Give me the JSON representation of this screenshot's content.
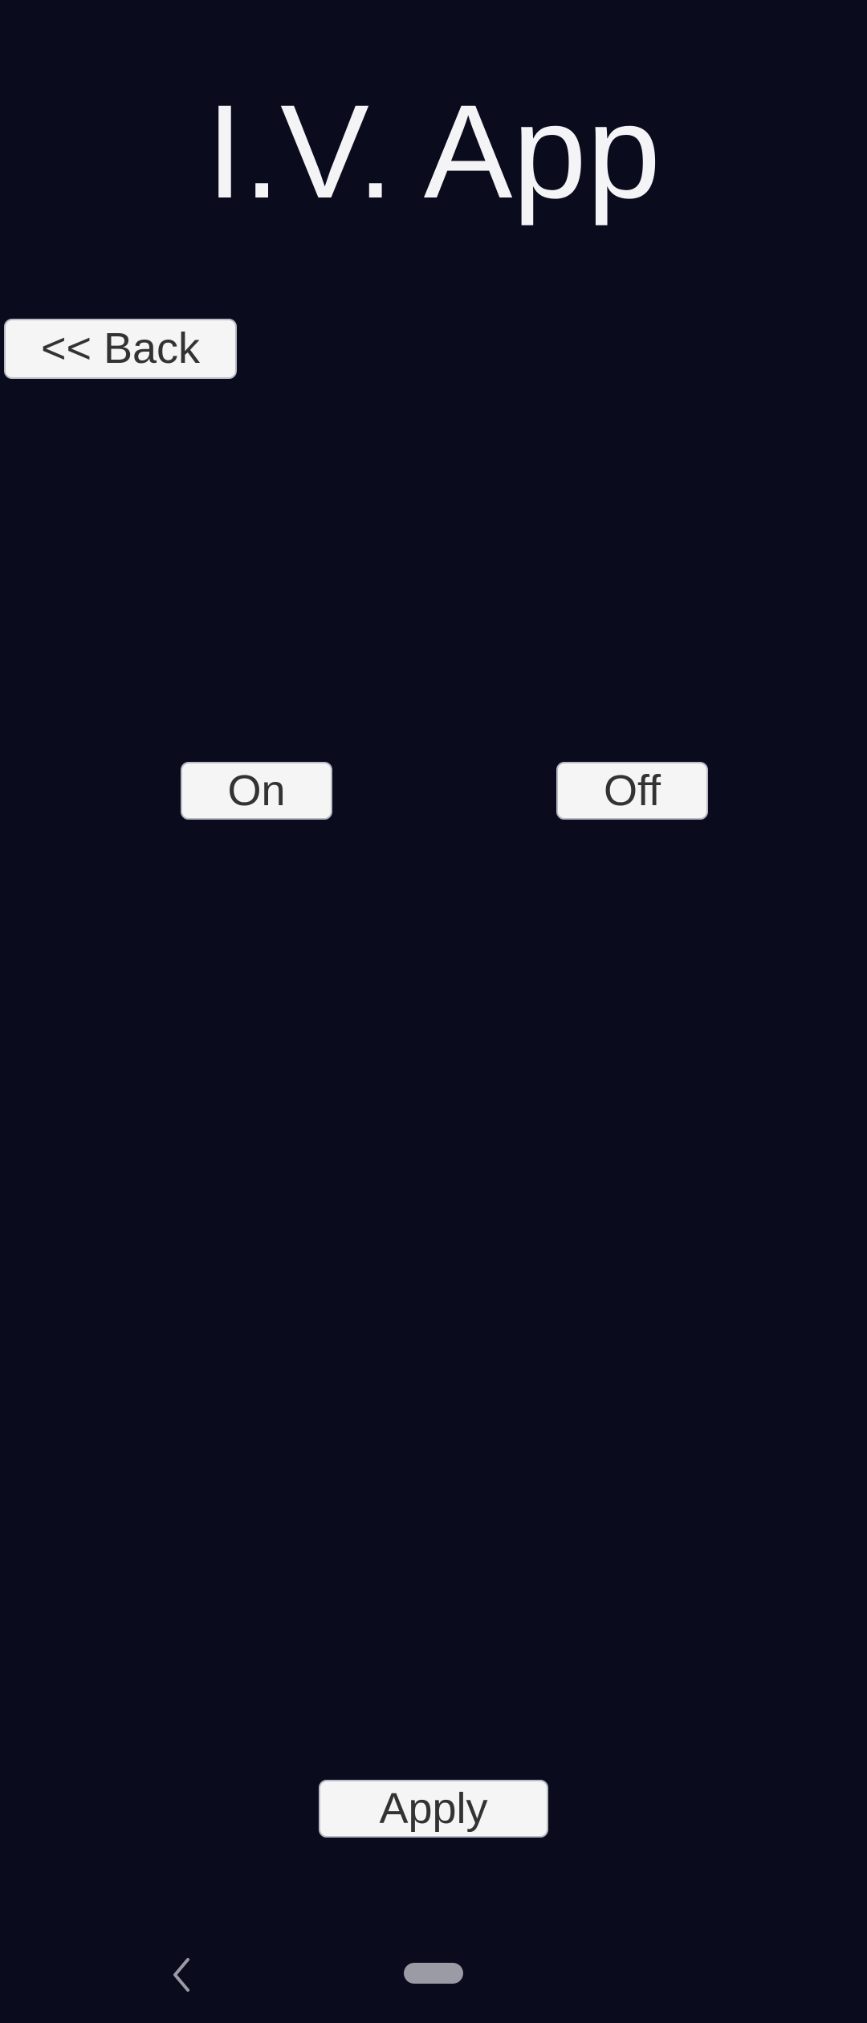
{
  "app": {
    "title": "I.V. App"
  },
  "buttons": {
    "back_label": "<< Back",
    "on_label": "On",
    "off_label": "Off",
    "apply_label": "Apply"
  },
  "system_nav": {
    "back_icon": "chevron-left-icon",
    "home_icon": "home-pill-icon"
  },
  "colors": {
    "background": "#0a0c1d",
    "title_text": "#f4f4f6",
    "button_bg": "#f5f5f5",
    "button_text": "#333333"
  }
}
